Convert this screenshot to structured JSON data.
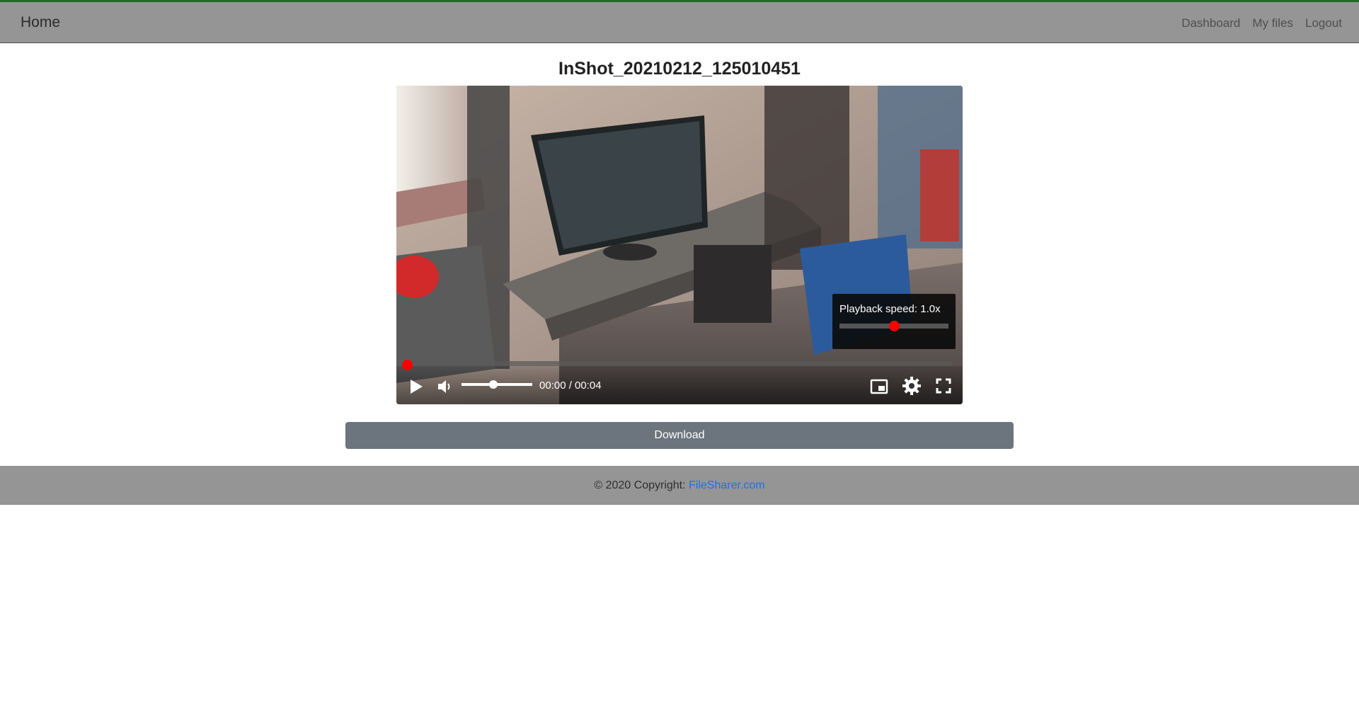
{
  "navbar": {
    "brand": "Home",
    "links": [
      "Dashboard",
      "My files",
      "Logout"
    ],
    "border_color": "#1e6b2a",
    "background": "#959595"
  },
  "page": {
    "title": "InShot_20210212_125010451"
  },
  "player": {
    "current_time": "00:00",
    "duration": "00:04",
    "time_display": "00:00 / 00:04",
    "progress_fraction": 0.0,
    "volume_fraction": 0.45,
    "playback_speed_label": "Playback speed: 1.0x",
    "playback_speed_fraction": 0.5,
    "accent_color": "#ff0000",
    "icons": [
      "play-icon",
      "volume-icon",
      "picture-in-picture-icon",
      "gear-icon",
      "fullscreen-icon"
    ]
  },
  "download": {
    "label": "Download",
    "color": "#6c757d"
  },
  "footer": {
    "copyright": "© 2020 Copyright: ",
    "link_text": "FileSharer.com",
    "link_color": "#1a73e8"
  }
}
